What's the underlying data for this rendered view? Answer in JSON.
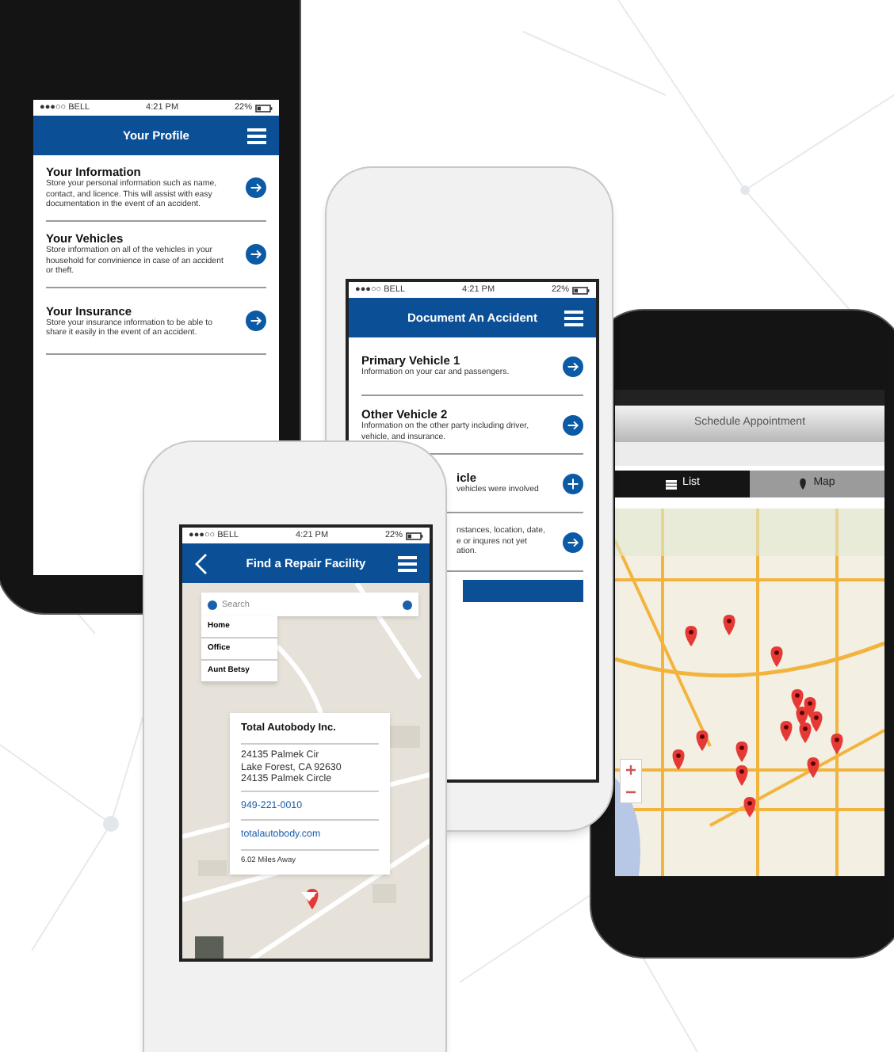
{
  "phones": [
    {
      "kind": "list_screen",
      "status_bar": {
        "carrier": "●●●○○ BELL",
        "time": "4:21 PM",
        "battery": "22%"
      },
      "header": {
        "title": "Your Profile"
      },
      "items": [
        {
          "title": "Your Information",
          "description": "Store your personal information such as name, contact, and licence. This will assist with easy documentation in the event of an accident.",
          "kind": "arrow"
        },
        {
          "title": "Your Vehicles",
          "description": "Store information on all of the vehicles in your household for convinience in case of an accident or theft.",
          "kind": "arrow"
        },
        {
          "title": "Your Insurance",
          "description": "Store your insurance information to be able to share it easily in the event of an accident.",
          "kind": "arrow"
        }
      ]
    },
    {
      "kind": "list_screen",
      "status_bar": {
        "carrier": "●●●○○ BELL",
        "time": "4:21 PM",
        "battery": "22%"
      },
      "header": {
        "title": "Document An Accident"
      },
      "items": [
        {
          "title": "Primary Vehicle 1",
          "description": "Information on your car and passengers.",
          "kind": "arrow"
        },
        {
          "title": "Other Vehicle 2",
          "description": "Information on the other party including driver, vehicle, and insurance.",
          "kind": "arrow"
        },
        {
          "title": "icle",
          "description_lines": [
            "vehicles were involved"
          ],
          "kind": "plus"
        },
        {
          "description_lines": [
            "nstances, location, date,",
            "e or inqures not yet",
            "ation."
          ],
          "kind": "arrow"
        }
      ]
    },
    {
      "kind": "schedule",
      "header": {
        "title": "Schedule Appointment"
      },
      "tabs": [
        {
          "label": "List",
          "selected": true
        },
        {
          "label": "Map",
          "selected": false
        }
      ]
    },
    {
      "kind": "map_search",
      "status_bar": {
        "carrier": "●●●○○ BELL",
        "time": "4:21 PM",
        "battery": "22%"
      },
      "header": {
        "title": "Find a Repair Facility"
      },
      "search": {
        "placeholder": "Search"
      },
      "saved_places": [
        "Home",
        "Office",
        "Aunt Betsy"
      ],
      "info_card": {
        "name": "Total Autobody Inc.",
        "address_lines": [
          "24135 Palmek Cir",
          "Lake Forest, CA 92630",
          "24135 Palmek Circle"
        ],
        "phone": "949-221-0010",
        "website": "totalautobody.com",
        "distance": "6.02 Miles Away"
      }
    }
  ]
}
